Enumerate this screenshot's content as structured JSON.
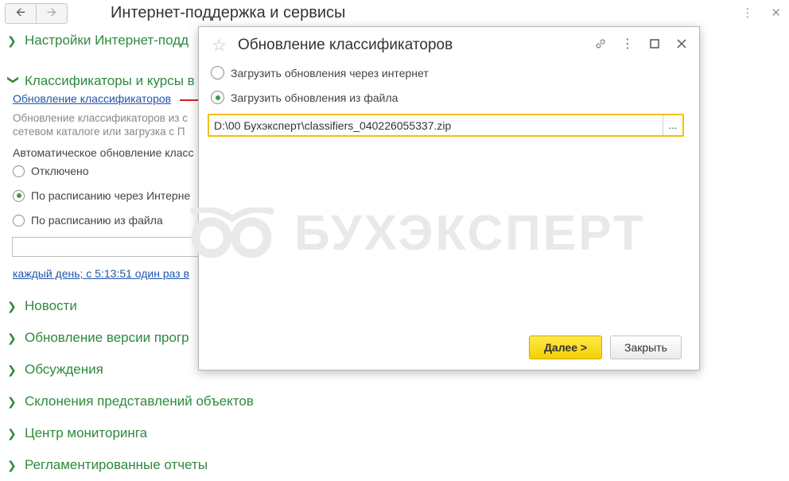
{
  "window": {
    "title": "Интернет-поддержка и сервисы",
    "back_icon": "arrow-left-icon",
    "forward_icon": "arrow-right-icon"
  },
  "tree": {
    "sections": [
      {
        "label": "Настройки Интернет-подд",
        "expanded": false
      },
      {
        "label": "Классификаторы и курсы в",
        "expanded": true
      },
      {
        "label": "Новости",
        "expanded": false
      },
      {
        "label": "Обновление версии прогр",
        "expanded": false
      },
      {
        "label": "Обсуждения",
        "expanded": false
      },
      {
        "label": "Склонения представлений объектов",
        "expanded": false
      },
      {
        "label": "Центр мониторинга",
        "expanded": false
      },
      {
        "label": "Регламентированные отчеты",
        "expanded": false
      }
    ],
    "classifiers": {
      "update_link": "Обновление классификаторов",
      "desc_line1": "Обновление классификаторов из с",
      "desc_line2": "сетевом каталоге или загрузка с П",
      "auto_label": "Автоматическое обновление класс",
      "options": [
        {
          "label": "Отключено",
          "selected": false
        },
        {
          "label": "По расписанию через Интерне",
          "selected": true
        },
        {
          "label": "По расписанию из файла",
          "selected": false
        }
      ],
      "file_value": "",
      "schedule_link": "каждый день; с 5:13:51 один раз в"
    }
  },
  "watermark": {
    "text": "БУХЭКСПЕРТ"
  },
  "dialog": {
    "title": "Обновление классификаторов",
    "options": [
      {
        "label": "Загрузить обновления через интернет",
        "selected": false
      },
      {
        "label": "Загрузить обновления из файла",
        "selected": true
      }
    ],
    "file_path": "D:\\00 Бухэксперт\\classifiers_040226055337.zip",
    "browse_label": "...",
    "next_label": "Далее >",
    "close_label": "Закрыть"
  },
  "colors": {
    "accent_green": "#2d8a3e",
    "link_blue": "#2255aa",
    "highlight_yellow": "#f2c200",
    "arrow_red": "#d42020"
  }
}
